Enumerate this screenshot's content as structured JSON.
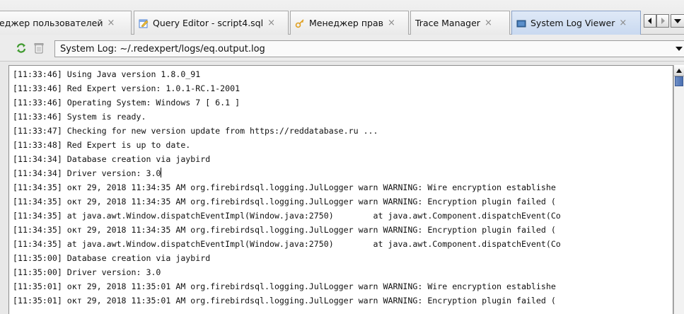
{
  "tabs": [
    {
      "label": "еджер пользователей",
      "icon": null,
      "active": false,
      "close": "×"
    },
    {
      "label": "Query Editor - script4.sql",
      "icon": "query-editor-icon",
      "active": false,
      "close": "×"
    },
    {
      "label": "Менеджер прав",
      "icon": "grants-manager-icon",
      "active": false,
      "close": "×"
    },
    {
      "label": "Trace Manager",
      "icon": null,
      "active": false,
      "close": "×"
    },
    {
      "label": "System Log Viewer",
      "icon": "system-log-icon",
      "active": true,
      "close": "×"
    }
  ],
  "tab_nav": {
    "prev_icon": "left-arrow-icon",
    "next_icon": "right-arrow-icon",
    "list_icon": "dropdown-arrow-icon"
  },
  "toolbar": {
    "reload_icon": "reload-icon",
    "clear_icon": "trash-icon",
    "log_select_value": "System Log: ~/.redexpert/logs/eq.output.log"
  },
  "log": {
    "lines": [
      "[11:33:46] Using Java version 1.8.0_91",
      "[11:33:46] Red Expert version: 1.0.1-RC.1-2001",
      "[11:33:46] Operating System: Windows 7 [ 6.1 ]",
      "[11:33:46] System is ready.",
      "[11:33:47] Checking for new version update from https://reddatabase.ru ...",
      "[11:33:48] Red Expert is up to date.",
      "[11:34:34] Database creation via jaybird",
      "[11:34:34] Driver version: 3.0",
      "[11:34:35] окт 29, 2018 11:34:35 AM org.firebirdsql.logging.JulLogger warn WARNING: Wire encryption establishe",
      "[11:34:35] окт 29, 2018 11:34:35 AM org.firebirdsql.logging.JulLogger warn WARNING: Encryption plugin failed (",
      "[11:34:35] at java.awt.Window.dispatchEventImpl(Window.java:2750)        at java.awt.Component.dispatchEvent(Co",
      "[11:34:35] окт 29, 2018 11:34:35 AM org.firebirdsql.logging.JulLogger warn WARNING: Encryption plugin failed (",
      "[11:34:35] at java.awt.Window.dispatchEventImpl(Window.java:2750)        at java.awt.Component.dispatchEvent(Co",
      "[11:35:00] Database creation via jaybird",
      "[11:35:00] Driver version: 3.0",
      "[11:35:01] окт 29, 2018 11:35:01 AM org.firebirdsql.logging.JulLogger warn WARNING: Wire encryption establishe",
      "[11:35:01] окт 29, 2018 11:35:01 AM org.firebirdsql.logging.JulLogger warn WARNING: Encryption plugin failed ("
    ],
    "caret_line": 7
  },
  "colors": {
    "active_tab": "#c9d9f0",
    "scroll_thumb": "#4a6fb0",
    "query_icon": "#4a7fd4",
    "log_icon": "#3a6ea8"
  }
}
